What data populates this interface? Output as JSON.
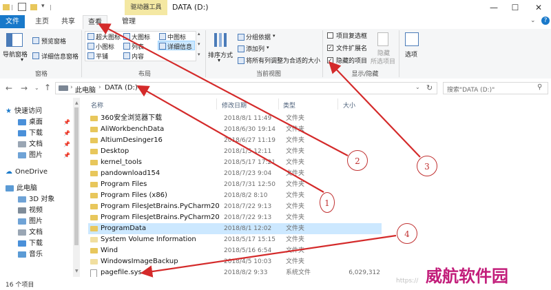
{
  "window": {
    "title": "DATA (D:)",
    "context_tab": "驱动器工具",
    "controls": {
      "minimize": "—",
      "maximize": "☐",
      "close": "✕",
      "help": "?"
    }
  },
  "ribbon_tabs": [
    "文件",
    "主页",
    "共享",
    "查看",
    "管理"
  ],
  "ribbon": {
    "panes": {
      "nav_pane": "导航窗格",
      "preview_pane": "预览窗格",
      "details_pane": "详细信息窗格",
      "group": "窗格"
    },
    "layout": {
      "items": [
        "超大图标",
        "大图标",
        "中图标",
        "小图标",
        "列表",
        "详细信息",
        "平铺",
        "内容"
      ],
      "group": "布局"
    },
    "current_view": {
      "sort": "排序方式",
      "group_by": "分组依据",
      "add_column": "添加列",
      "fit_columns": "将所有列调整为合适的大小",
      "group": "当前视图"
    },
    "show_hide": {
      "item_checkboxes": "项目复选框",
      "file_extensions": "文件扩展名",
      "hidden_items": "隐藏的项目",
      "hide_selected": "隐藏",
      "hide_selected_2": "所选项目",
      "group": "显示/隐藏"
    },
    "options": "选项"
  },
  "address": {
    "crumbs": [
      "此电脑",
      "DATA (D:)"
    ],
    "search_placeholder": "搜索\"DATA (D:)\""
  },
  "nav_pane": {
    "items": [
      {
        "label": "快速访问",
        "pinned": false
      },
      {
        "label": "桌面",
        "pinned": true
      },
      {
        "label": "下载",
        "pinned": true
      },
      {
        "label": "文档",
        "pinned": true
      },
      {
        "label": "图片",
        "pinned": true
      },
      {
        "label": "OneDrive",
        "pinned": false
      },
      {
        "label": "此电脑",
        "pinned": false
      },
      {
        "label": "3D 对象",
        "pinned": false
      },
      {
        "label": "视频",
        "pinned": false
      },
      {
        "label": "图片",
        "pinned": false
      },
      {
        "label": "文档",
        "pinned": false
      },
      {
        "label": "下载",
        "pinned": false
      },
      {
        "label": "音乐",
        "pinned": false
      }
    ]
  },
  "columns": [
    "名称",
    "修改日期",
    "类型",
    "大小"
  ],
  "files": [
    {
      "name": "360安全浏览器下载",
      "date": "2018/8/1 11:49",
      "type": "文件夹",
      "size": ""
    },
    {
      "name": "AliWorkbenchData",
      "date": "2018/6/30 19:14",
      "type": "文件夹",
      "size": ""
    },
    {
      "name": "AltiumDesinger16",
      "date": "2018/6/27 11:19",
      "type": "文件夹",
      "size": ""
    },
    {
      "name": "Desktop",
      "date": "2018/1/5 12:11",
      "type": "文件夹",
      "size": ""
    },
    {
      "name": "kernel_tools",
      "date": "2018/5/17 17:21",
      "type": "文件夹",
      "size": ""
    },
    {
      "name": "pandownload154",
      "date": "2018/7/23 9:04",
      "type": "文件夹",
      "size": ""
    },
    {
      "name": "Program Files",
      "date": "2018/7/31 12:50",
      "type": "文件夹",
      "size": ""
    },
    {
      "name": "Program Files (x86)",
      "date": "2018/8/2 8:10",
      "type": "文件夹",
      "size": ""
    },
    {
      "name": "Program FilesJetBrains.PyCharm2018…",
      "date": "2018/7/22 9:13",
      "type": "文件夹",
      "size": ""
    },
    {
      "name": "Program FilesJetBrains.PyCharm2018…",
      "date": "2018/7/22 9:13",
      "type": "文件夹",
      "size": ""
    },
    {
      "name": "ProgramData",
      "date": "2018/8/1 12:02",
      "type": "文件夹",
      "size": ""
    },
    {
      "name": "System Volume Information",
      "date": "2018/5/17 15:15",
      "type": "文件夹",
      "size": ""
    },
    {
      "name": "Wind",
      "date": "2018/5/16 6:54",
      "type": "文件夹",
      "size": ""
    },
    {
      "name": "WindowsImageBackup",
      "date": "2018/4/5 10:03",
      "type": "文件夹",
      "size": ""
    },
    {
      "name": "pagefile.sys",
      "date": "2018/8/2 9:33",
      "type": "系统文件",
      "size": "6,029,312"
    }
  ],
  "status": {
    "count": "16 个项目"
  },
  "annotations": [
    "1",
    "2",
    "3",
    "4"
  ],
  "watermark": {
    "text": "威航软件园",
    "url": "https://"
  },
  "colors": {
    "file_tab": "#1979ca",
    "context_tab": "#f4e8a3",
    "arrow": "#d42a2a",
    "selection": "#cce8ff",
    "watermark": "#c21d7a"
  }
}
